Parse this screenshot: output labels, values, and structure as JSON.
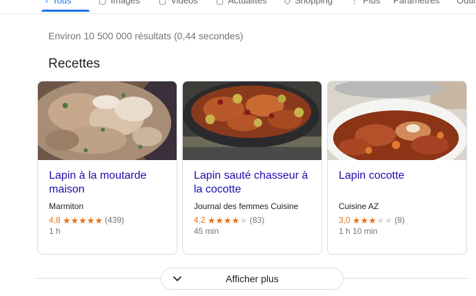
{
  "nav": {
    "tabs": [
      {
        "label": "Tous",
        "icon": "search-icon"
      },
      {
        "label": "Images",
        "icon": "image-icon"
      },
      {
        "label": "Vidéos",
        "icon": "video-icon"
      },
      {
        "label": "Actualités",
        "icon": "news-icon"
      },
      {
        "label": "Shopping",
        "icon": "tag-icon"
      },
      {
        "label": "Plus",
        "icon": "more-icon"
      },
      {
        "label": "Paramètres",
        "icon": ""
      },
      {
        "label": "Outils",
        "icon": ""
      }
    ],
    "accent": "#1a73e8"
  },
  "stats": "Environ 10 500 000 résultats (0,44 secondes)",
  "section_title": "Recettes",
  "recipes": [
    {
      "title": "Lapin à la moutarde maison",
      "source": "Marmiton",
      "rating": "4,8",
      "stars": 5,
      "reviews": "(439)",
      "time": "1 h"
    },
    {
      "title": "Lapin sauté chasseur à la cocotte",
      "source": "Journal des femmes Cuisine",
      "rating": "4,2",
      "stars": 4,
      "reviews": "(83)",
      "time": "45 min"
    },
    {
      "title": "Lapin cocotte",
      "source": "Cuisine AZ",
      "rating": "3,0",
      "stars": 3,
      "reviews": "(8)",
      "time": "1 h 10 min"
    }
  ],
  "more_button": "Afficher plus",
  "colors": {
    "link": "#1a0dab",
    "star": "#e7711b",
    "muted": "#70757a",
    "border": "#dadce0"
  }
}
